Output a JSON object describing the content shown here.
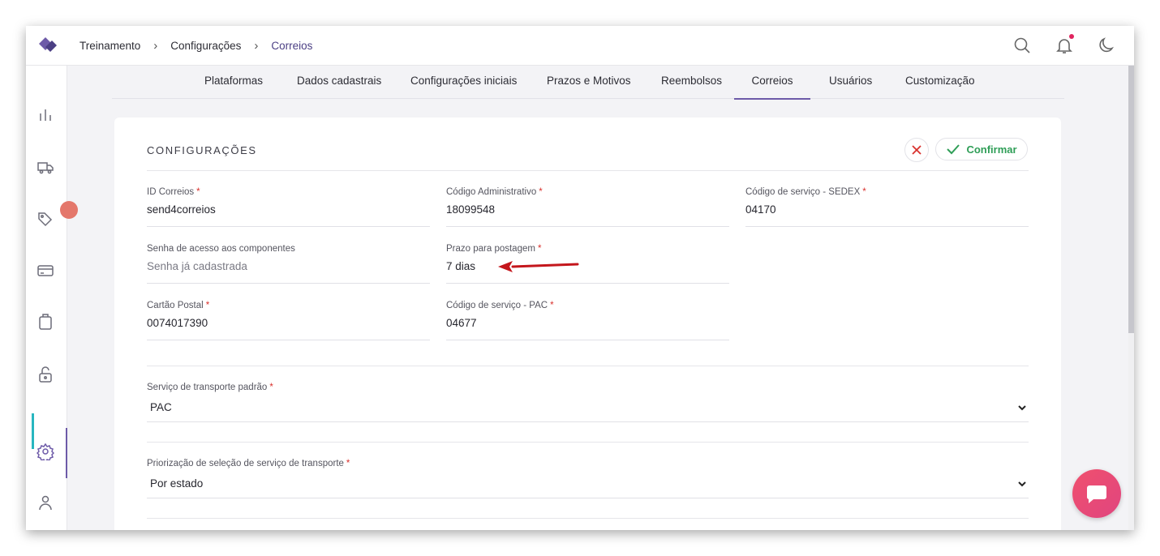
{
  "breadcrumb": {
    "items": [
      "Treinamento",
      "Configurações",
      "Correios"
    ],
    "separator": "›"
  },
  "header_icons": [
    "search-icon",
    "bell-icon",
    "moon-icon"
  ],
  "sidebar": {
    "items": [
      "chart-icon",
      "truck-icon",
      "tag-icon",
      "credit-card-icon",
      "clipboard-icon",
      "unlock-icon",
      "gear-icon",
      "user-icon"
    ]
  },
  "tabs": [
    "Plataformas",
    "Dados cadastrais",
    "Configurações iniciais",
    "Prazos e Motivos",
    "Reembolsos",
    "Correios",
    "Usuários",
    "Customização"
  ],
  "active_tab": "Correios",
  "card": {
    "title": "CONFIGURAÇÕES",
    "confirm_label": "Confirmar"
  },
  "fields": {
    "id_correios": {
      "label": "ID Correios",
      "required": "*",
      "value": "send4correios"
    },
    "codigo_admin": {
      "label": "Código Administrativo",
      "required": "*",
      "value": "18099548"
    },
    "codigo_sedex": {
      "label": "Código de serviço - SEDEX",
      "required": "*",
      "value": "04170"
    },
    "senha": {
      "label": "Senha de acesso aos componentes",
      "placeholder": "Senha já cadastrada"
    },
    "prazo": {
      "label": "Prazo para postagem",
      "required": "*",
      "value": "7 dias"
    },
    "cartao": {
      "label": "Cartão Postal",
      "required": "*",
      "value": "0074017390"
    },
    "codigo_pac": {
      "label": "Código de serviço - PAC",
      "required": "*",
      "value": "04677"
    }
  },
  "selects": {
    "servico_padrao": {
      "label": "Serviço de transporte padrão",
      "required": "*",
      "value": "PAC"
    },
    "priorizacao": {
      "label": "Priorização de seleção de serviço de transporte",
      "required": "*",
      "value": "Por estado"
    }
  },
  "colors": {
    "accent": "#6d5aa8",
    "confirm": "#2f9e57",
    "cancel": "#d9302c",
    "chat": "#f0506e",
    "active_indicator": "#28b6c0"
  }
}
